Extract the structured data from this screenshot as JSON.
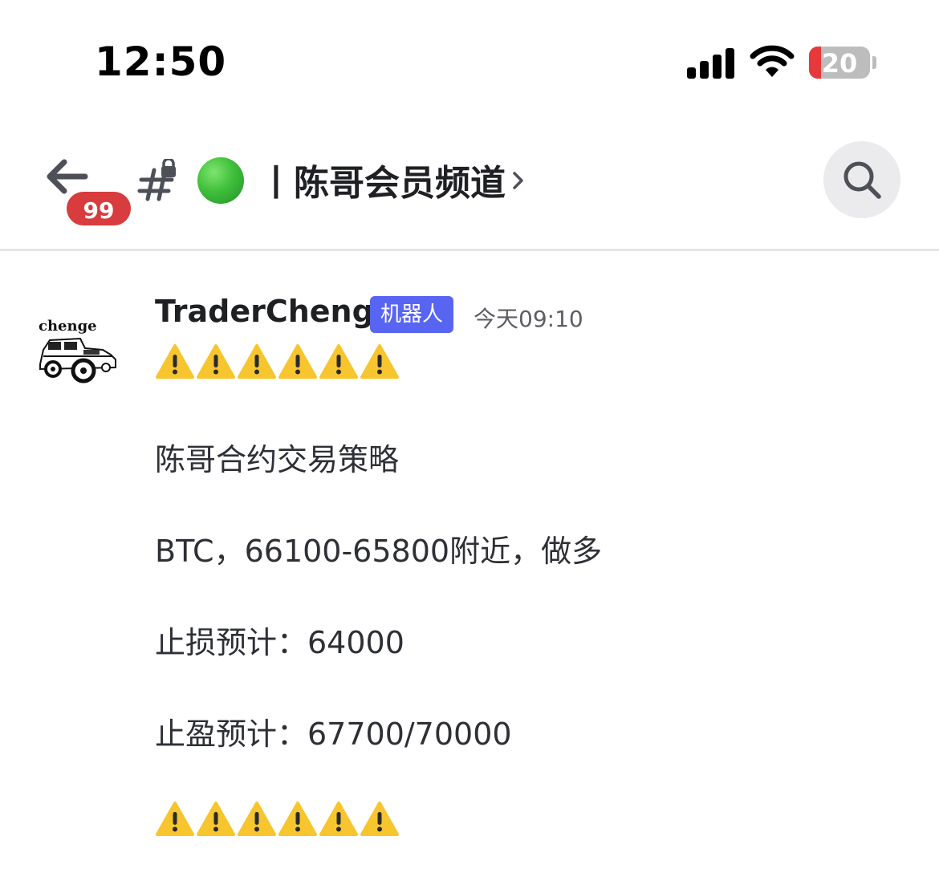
{
  "status_bar": {
    "time": "12:50",
    "battery_level": "20",
    "battery_fraction": 0.2,
    "icons": [
      "cellular-signal-icon",
      "wifi-icon",
      "battery-icon"
    ]
  },
  "header": {
    "unread_badge": "99",
    "channel_emoji": "green-circle",
    "channel_name": "丨陈哥会员频道",
    "icons": [
      "back-arrow-icon",
      "locked-channel-hash-icon",
      "chevron-right-icon",
      "search-icon"
    ]
  },
  "message": {
    "avatar_text": "chenge",
    "author": "TraderChenge",
    "bot_tag": "机器人",
    "timestamp": "今天09:10",
    "warning_emoji_count": 6,
    "lines": [
      "陈哥合约交易策略",
      "BTC，66100-65800附近，做多",
      "止损预计：64000",
      "止盈预计：67700/70000"
    ]
  },
  "colors": {
    "accent_blurple": "#5865f2",
    "badge_red": "#d83c3e",
    "text_primary": "#1f2024",
    "text_muted": "#5c5e66",
    "warning_yellow": "#f7c52e"
  }
}
